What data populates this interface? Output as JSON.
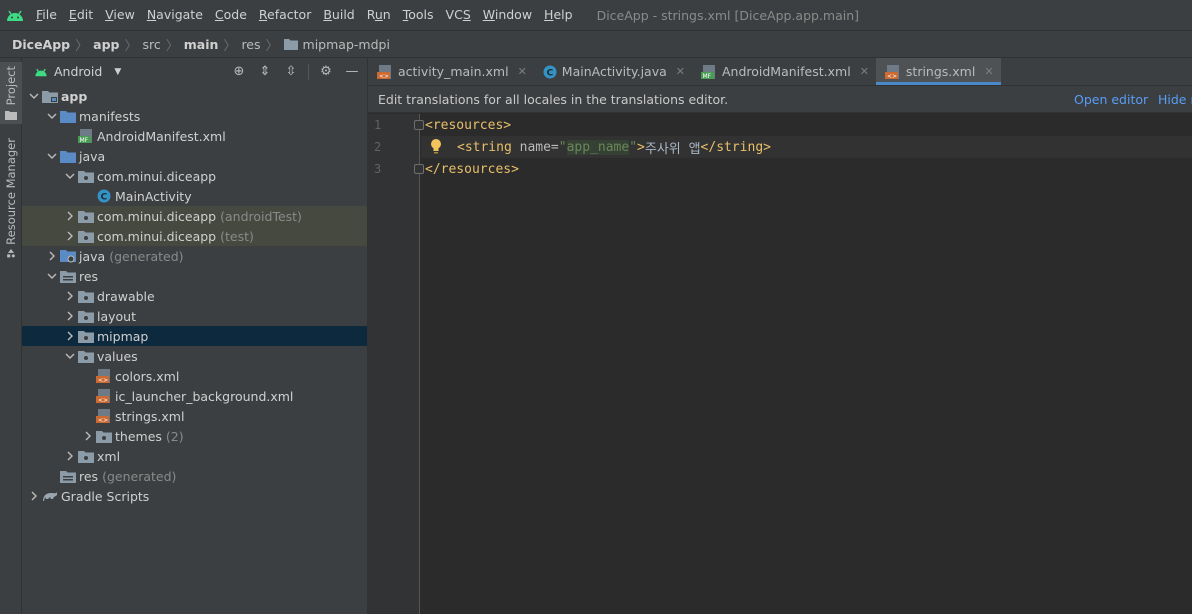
{
  "menubar": {
    "items": [
      "File",
      "Edit",
      "View",
      "Navigate",
      "Code",
      "Refactor",
      "Build",
      "Run",
      "Tools",
      "VCS",
      "Window",
      "Help"
    ],
    "mnemonics": [
      "F",
      "E",
      "V",
      "N",
      "C",
      "R",
      "B",
      "u",
      "T",
      "S",
      "W",
      "H"
    ],
    "window_title": "DiceApp - strings.xml [DiceApp.app.main]"
  },
  "breadcrumb": [
    "DiceApp",
    "app",
    "src",
    "main",
    "res",
    "mipmap-mdpi"
  ],
  "toolstrip": {
    "project_label": "Project",
    "resource_label": "Resource Manager"
  },
  "project_panel": {
    "view_mode": "Android",
    "tree": [
      {
        "label": "app",
        "depth": 0,
        "expanded": true,
        "icon": "module-folder-icon",
        "bold": true
      },
      {
        "label": "manifests",
        "depth": 1,
        "expanded": true,
        "icon": "folder-icon"
      },
      {
        "label": "AndroidManifest.xml",
        "depth": 2,
        "leaf": true,
        "icon": "manifest-file-icon"
      },
      {
        "label": "java",
        "depth": 1,
        "expanded": true,
        "icon": "folder-icon"
      },
      {
        "label": "com.minui.diceapp",
        "depth": 2,
        "expanded": true,
        "icon": "package-icon"
      },
      {
        "label": "MainActivity",
        "depth": 3,
        "leaf": true,
        "icon": "class-icon"
      },
      {
        "label": "com.minui.diceapp",
        "suffix": "(androidTest)",
        "depth": 2,
        "expanded": false,
        "icon": "package-icon",
        "highlight": "green"
      },
      {
        "label": "com.minui.diceapp",
        "suffix": "(test)",
        "depth": 2,
        "expanded": false,
        "icon": "package-icon",
        "highlight": "green"
      },
      {
        "label": "java",
        "suffix": "(generated)",
        "depth": 1,
        "expanded": false,
        "icon": "generated-folder-icon"
      },
      {
        "label": "res",
        "depth": 1,
        "expanded": true,
        "icon": "res-folder-icon"
      },
      {
        "label": "drawable",
        "depth": 2,
        "expanded": false,
        "icon": "package-icon"
      },
      {
        "label": "layout",
        "depth": 2,
        "expanded": false,
        "icon": "package-icon"
      },
      {
        "label": "mipmap",
        "depth": 2,
        "expanded": false,
        "icon": "package-icon",
        "highlight": "selected"
      },
      {
        "label": "values",
        "depth": 2,
        "expanded": true,
        "icon": "package-icon"
      },
      {
        "label": "colors.xml",
        "depth": 3,
        "leaf": true,
        "icon": "xml-file-icon"
      },
      {
        "label": "ic_launcher_background.xml",
        "depth": 3,
        "leaf": true,
        "icon": "xml-file-icon"
      },
      {
        "label": "strings.xml",
        "depth": 3,
        "leaf": true,
        "icon": "xml-file-icon"
      },
      {
        "label": "themes",
        "suffix": "(2)",
        "depth": 3,
        "expanded": false,
        "icon": "package-icon"
      },
      {
        "label": "xml",
        "depth": 2,
        "expanded": false,
        "icon": "package-icon"
      },
      {
        "label": "res",
        "suffix": "(generated)",
        "depth": 1,
        "leaf": true,
        "icon": "res-folder-icon"
      },
      {
        "label": "Gradle Scripts",
        "depth": 0,
        "expanded": false,
        "icon": "gradle-icon"
      }
    ]
  },
  "editor": {
    "tabs": [
      {
        "label": "activity_main.xml",
        "icon": "xml-file-icon",
        "active": false
      },
      {
        "label": "MainActivity.java",
        "icon": "class-icon",
        "active": false
      },
      {
        "label": "AndroidManifest.xml",
        "icon": "manifest-file-icon",
        "active": false
      },
      {
        "label": "strings.xml",
        "icon": "xml-file-icon",
        "active": true
      }
    ],
    "banner": {
      "message": "Edit translations for all locales in the translations editor.",
      "open_editor": "Open editor",
      "hide": "Hide n"
    },
    "line_numbers": [
      "1",
      "2",
      "3"
    ],
    "code": {
      "line1": "<resources>",
      "line2_open": "<string",
      "line2_attr": " name=",
      "line2_q1": "\"",
      "line2_value": "app_name",
      "line2_q2": "\"",
      "line2_gt": ">",
      "line2_text": "주사위 앱",
      "line2_close": "</string>",
      "line3": "</resources>"
    }
  },
  "colors": {
    "accent": "#4a88c7",
    "link": "#589df6",
    "xml_tag": "#e8bf6a",
    "xml_value": "#6a8759",
    "android_green": "#3ddc84",
    "folder_blue": "#5b8bc4"
  }
}
